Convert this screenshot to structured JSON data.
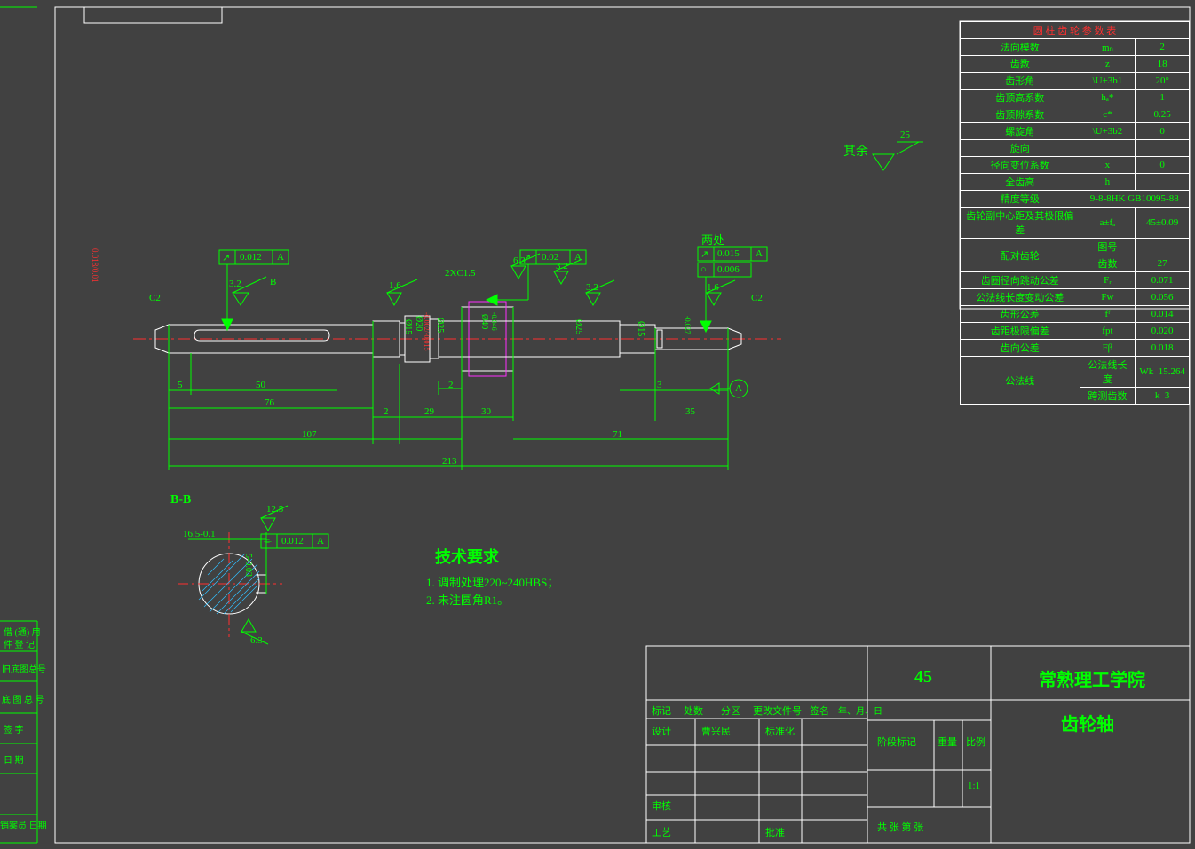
{
  "domain": "Diagram",
  "page": {
    "other_text": "其余",
    "other_val": "25",
    "two_places": "两处",
    "tech_title": "技术要求",
    "tech_1": "1. 调制处理220~240HBS；",
    "tech_2": "2. 未注圆角R1。",
    "section_label": "B-B"
  },
  "fcf": {
    "runout1_val": "0.012",
    "runout1_ref": "A",
    "runout2_val": "0.02",
    "runout2_ref": "A",
    "runout3_val": "0.015",
    "runout3_ref": "A",
    "circ_val": "0.006",
    "sym_val": "0.012",
    "sym_ref": "A"
  },
  "dims": {
    "datum_b": "B",
    "datum_a": "A",
    "c2_left": "C2",
    "c2_right": "C2",
    "chamfer": "2XC1.5",
    "ra32a": "3.2",
    "ra32b": "3.2",
    "ra32c": "3.2",
    "ra63": "6.3",
    "ra16a": "1.6",
    "ra16b": "1.6",
    "ra125": "12.5",
    "ra63b": "6.3",
    "l5": "5",
    "l50": "50",
    "l76": "76",
    "l2a": "2",
    "l29": "29",
    "l2b": "2",
    "l30": "30",
    "l3": "3",
    "l35": "35",
    "l71": "71",
    "l107": "107",
    "l213": "213",
    "d15": "Ø15",
    "d20": "Ø20",
    "d25": "Ø25",
    "d40": "Ø40",
    "d25b": "Ø25",
    "d15b": "Ø15",
    "d20tol": "-0.002/-0.015",
    "d40tol": "-0.046",
    "d15rtol": "-0.027",
    "key": "16.5-0.1",
    "key_h": "5-0.03",
    "bb_tol": "0.018/0.01"
  },
  "gear": {
    "title": "圆 柱 齿 轮 参 数 表",
    "rows": [
      [
        "法向模数",
        "mₙ",
        "2"
      ],
      [
        "齿数",
        "z",
        "18"
      ],
      [
        "齿形角",
        "\\U+3b1",
        "20°"
      ],
      [
        "齿顶高系数",
        "hₐ*",
        "1"
      ],
      [
        "齿顶隙系数",
        "c*",
        "0.25"
      ],
      [
        "螺旋角",
        "\\U+3b2",
        "0"
      ],
      [
        "旋向",
        "",
        ""
      ],
      [
        "径向变位系数",
        "x",
        "0"
      ],
      [
        "全齿高",
        "h",
        ""
      ],
      [
        "精度等级",
        "9-8-8HK GB10095-88",
        ""
      ]
    ],
    "pair_label": "齿轮副中心距及其极限偏差",
    "pair_sym": "a±fₐ",
    "pair_val": "45±0.09",
    "mate_label": "配对齿轮",
    "mate_row1": "图号",
    "mate_row2": "齿数",
    "mate_val2": "27",
    "tol": [
      [
        "齿圈径向跳动公差",
        "Fᵣ",
        "0.071"
      ],
      [
        "公法线长度变动公差",
        "Fw",
        "0.056"
      ],
      [
        "齿形公差",
        "fᶠ",
        "0.014"
      ],
      [
        "齿距极限偏差",
        "fpt",
        "0.020"
      ],
      [
        "齿向公差",
        "Fβ",
        "0.018"
      ]
    ],
    "span_label": "公法线",
    "span1_l": "公法线长度",
    "span1_s": "Wk",
    "span1_v": "15.264",
    "span2_l": "跨测齿数",
    "span2_s": "k",
    "span2_v": "3"
  },
  "titleblock": {
    "material": "45",
    "org": "常熟理工学院",
    "part": "齿轮轴",
    "h1": "标记",
    "h2": "处数",
    "h3": "分区",
    "h4": "更改文件号",
    "h5": "签名",
    "h6": "年、月、日",
    "r1a": "设计",
    "r1b": "曹兴民",
    "r1c": "标准化",
    "r2a": "审核",
    "r3a": "工艺",
    "r3b": "批准",
    "stage": "阶段标记",
    "weight": "重量",
    "scale": "比例",
    "scale_v": "1:1",
    "sheets": "共    张    第    张"
  },
  "sidebar": {
    "s1": "借 (通) 用",
    "s1b": "件  登  记",
    "s2": "旧底图总号",
    "s3": "底 图 总 号",
    "s4": "签    字",
    "s5": "日    期",
    "s6": "销案员    日期"
  }
}
